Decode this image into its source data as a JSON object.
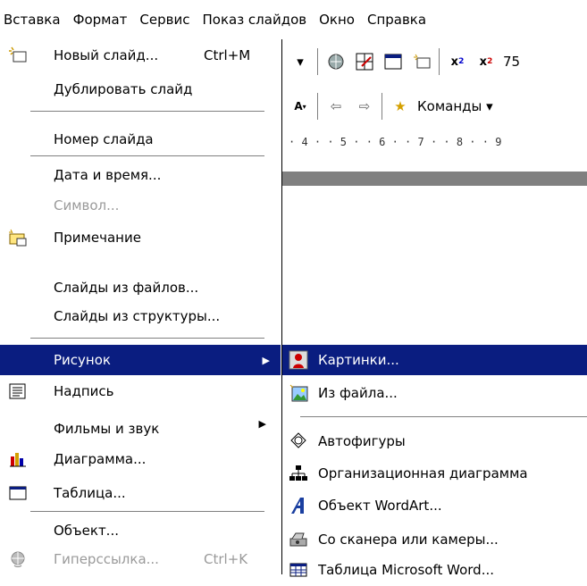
{
  "menubar": [
    "Вставка",
    "Формат",
    "Сервис",
    "Показ слайдов",
    "Окно",
    "Справка"
  ],
  "toolbar1": {
    "zoom": "75"
  },
  "toolbar2": {
    "commands_label": "Команды ▾"
  },
  "ruler": {
    "text": "· 4 · · 5 · · 6 · · 7 · · 8 · · 9"
  },
  "insert_menu": [
    {
      "label": "Новый слайд...",
      "shortcut": "Ctrl+M",
      "icon": "new-slide-icon"
    },
    {
      "label": "Дублировать слайд"
    },
    {
      "label": "Номер слайда"
    },
    {
      "label": "Дата и время..."
    },
    {
      "label": "Символ...",
      "disabled": true
    },
    {
      "label": "Примечание",
      "icon": "comment-icon"
    },
    {
      "label": "Слайды из файлов..."
    },
    {
      "label": "Слайды из структуры..."
    },
    {
      "label": "Рисунок",
      "submenu": true,
      "highlighted": true
    },
    {
      "label": "Надпись",
      "icon": "textbox-icon"
    },
    {
      "label": "Фильмы и звук",
      "submenu": true
    },
    {
      "label": "Диаграмма...",
      "icon": "chart-icon"
    },
    {
      "label": "Таблица...",
      "icon": "table-icon"
    },
    {
      "label": "Объект..."
    },
    {
      "label": "Гиперссылка...",
      "shortcut": "Ctrl+K",
      "disabled": true,
      "icon": "hyperlink-icon"
    }
  ],
  "picture_submenu": [
    {
      "label": "Картинки...",
      "icon": "clipart-icon",
      "highlighted": true
    },
    {
      "label": "Из файла...",
      "icon": "from-file-icon"
    },
    {
      "label": "Автофигуры",
      "icon": "autoshapes-icon"
    },
    {
      "label": "Организационная диаграмма",
      "icon": "org-chart-icon"
    },
    {
      "label": "Объект WordArt...",
      "icon": "wordart-icon"
    },
    {
      "label": "Со сканера или камеры...",
      "icon": "scanner-icon"
    },
    {
      "label": "Таблица Microsoft Word...",
      "icon": "word-table-icon"
    }
  ],
  "colors": {
    "highlight": "#0a1d80",
    "disabled": "#9a9a9a",
    "separator": "#808080"
  }
}
